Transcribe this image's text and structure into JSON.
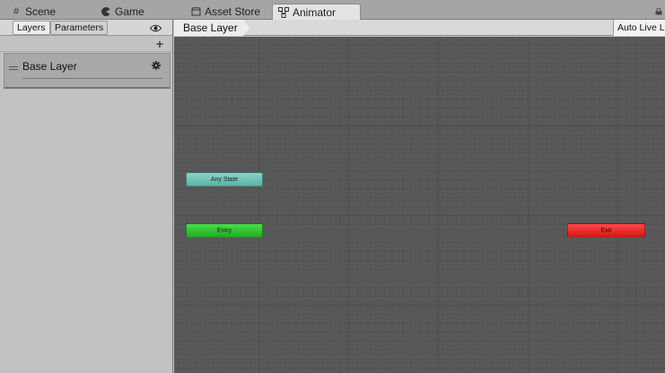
{
  "tabs": [
    {
      "label": "Scene",
      "icon": "grid-icon"
    },
    {
      "label": "Game",
      "icon": "pacman-icon"
    },
    {
      "label": "Asset Store",
      "icon": "store-icon"
    },
    {
      "label": "Animator",
      "icon": "animator-icon",
      "active": true
    }
  ],
  "left_panel": {
    "tabs": [
      {
        "label": "Layers",
        "active": true
      },
      {
        "label": "Parameters"
      }
    ],
    "layers": [
      {
        "name": "Base Layer"
      }
    ]
  },
  "breadcrumb": {
    "label": "Base Layer"
  },
  "toolbar": {
    "auto_live_link": "Auto Live Li"
  },
  "graph": {
    "nodes": [
      {
        "label": "Any State",
        "color": "#6fc3b8"
      },
      {
        "label": "Entry",
        "color": "#2ec72e"
      },
      {
        "label": "Exit",
        "color": "#e82424"
      }
    ]
  }
}
